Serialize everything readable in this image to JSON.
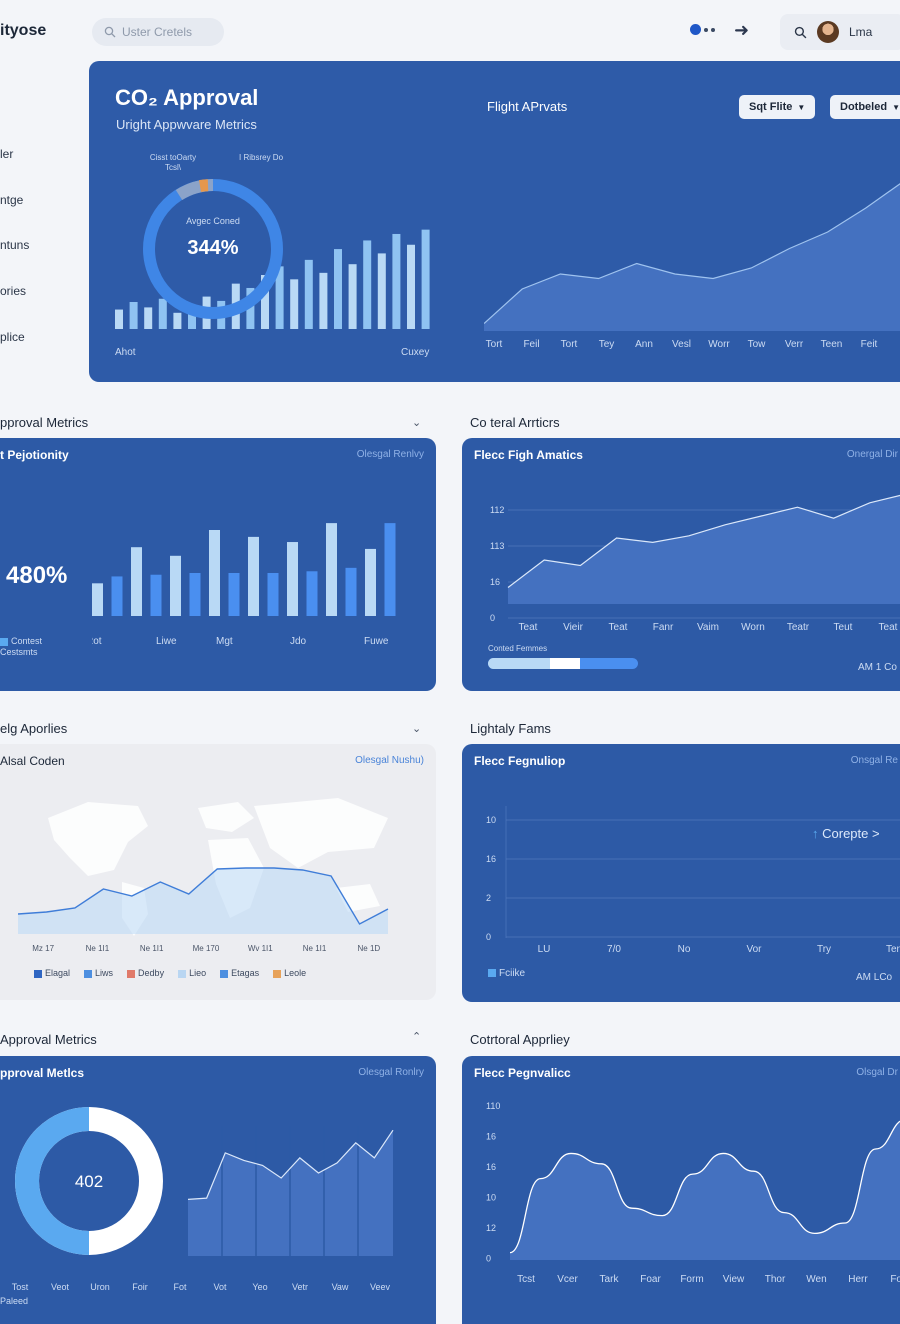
{
  "app": {
    "brand": "ityose",
    "search_placeholder": "Uster Cretels",
    "user_name": "Lma"
  },
  "sidebar": {
    "items": [
      "ler",
      "ntge",
      "ntuns",
      "ories",
      "plice"
    ]
  },
  "hero": {
    "title": "CO₂ Approval",
    "subtitle": "Uright Appwvare Metrics",
    "donut": {
      "label_top_left": "Cisst toOarty Tcsl\\",
      "label_top_right": "I Ribsrey Do",
      "center_caption": "Avgec Coned",
      "value": "344%",
      "percent": 344
    },
    "bars_left_label": "Ahot",
    "bars_right_label": "Cuxey",
    "bars": [
      0.18,
      0.25,
      0.2,
      0.28,
      0.15,
      0.22,
      0.3,
      0.26,
      0.42,
      0.38,
      0.5,
      0.58,
      0.46,
      0.64,
      0.52,
      0.74,
      0.6,
      0.82,
      0.7,
      0.88,
      0.78,
      0.92
    ],
    "right_title": "Flight APrvats",
    "filter_label": "Sqt Flite",
    "detail_label": "Dotbeled",
    "area_x": [
      "Tort",
      "Feil",
      "Tort",
      "Tey",
      "Ann",
      "Vesl",
      "Worr",
      "Tow",
      "Verr",
      "Teen",
      "Feit"
    ],
    "area_values": [
      0.05,
      0.28,
      0.38,
      0.35,
      0.45,
      0.38,
      0.35,
      0.42,
      0.55,
      0.66,
      0.82,
      1.0
    ]
  },
  "section2": {
    "left_heading": "pproval Metrics",
    "right_heading": "Co teral Arrticrs",
    "left_card": {
      "title": "t Pejotionity",
      "link": "Olesgal Renlvy",
      "value": "480%",
      "legend": "Contest Cestsmts",
      "x_labels": [
        "Rot",
        "Liwe",
        "Mgt",
        "Jdo",
        "Fuwe"
      ],
      "bars": [
        0.38,
        0.46,
        0.8,
        0.48,
        0.7,
        0.5,
        1.0,
        0.5,
        0.92,
        0.5,
        0.86,
        0.52,
        1.08,
        0.56,
        0.78,
        1.08
      ]
    },
    "right_card": {
      "title": "Flecc Figh Amatics",
      "link": "Onergal Dir",
      "y_ticks": [
        "112",
        "113",
        "16",
        "0"
      ],
      "x_labels": [
        "Teat",
        "Vieir",
        "Teat",
        "Fanr",
        "Vaim",
        "Worn",
        "Teatr",
        "Teut",
        "Teat"
      ],
      "values": [
        0.15,
        0.4,
        0.35,
        0.6,
        0.56,
        0.62,
        0.72,
        0.8,
        0.88,
        0.78,
        0.92,
        1.0
      ],
      "progress_label": "Conted Femmes",
      "progress": 0.6,
      "footer": "AM 1 Co"
    }
  },
  "section3": {
    "left_heading": "elg Aporlies",
    "right_heading": "Lightaly Fams",
    "left_card": {
      "title": "Alsal Coden",
      "link": "Olesgal Nushu)",
      "x_labels": [
        "Mz 17",
        "Ne 1I1",
        "Ne 1I1",
        "Me 170",
        "Wv 1I1",
        "Ne 1I1",
        "Ne 1D"
      ],
      "legend": [
        {
          "label": "Elagal",
          "color": "#2f66c2"
        },
        {
          "label": "Liws",
          "color": "#4d8fe0"
        },
        {
          "label": "Dedby",
          "color": "#e07a6a"
        },
        {
          "label": "Lieo",
          "color": "#b9d6f2"
        },
        {
          "label": "Etagas",
          "color": "#4d8fe0"
        },
        {
          "label": "Leole",
          "color": "#e7a25a"
        }
      ],
      "values": [
        0.2,
        0.22,
        0.26,
        0.45,
        0.38,
        0.52,
        0.4,
        0.65,
        0.66,
        0.66,
        0.64,
        0.58,
        0.1,
        0.25
      ]
    },
    "right_card": {
      "title": "Flecc Fegnuliop",
      "link": "Onsgal Re",
      "y_ticks": [
        "10",
        "16",
        "2",
        "0"
      ],
      "x_labels": [
        "LU",
        "7/0",
        "No",
        "Vor",
        "Try",
        "Ten"
      ],
      "compare_label": "Corepte >",
      "legend": "Fciike",
      "footer": "AM LCo"
    }
  },
  "section4": {
    "left_heading": "Approval Metrics",
    "right_heading": "Cotrtoral Apprliey",
    "left_card": {
      "title": "pproval Metlcs",
      "link": "Olesgal Ronlry",
      "donut_value": "402",
      "donut_fraction": 0.5,
      "x_labels": [
        "Tost",
        "Veot",
        "Uron",
        "Foir",
        "Fot",
        "Vot",
        "Yeo",
        "Vetr",
        "Vaw",
        "Veev"
      ],
      "footer_label": "Paleed",
      "values": [
        0.45,
        0.46,
        0.82,
        0.76,
        0.72,
        0.62,
        0.78,
        0.66,
        0.74,
        0.9,
        0.78,
        1.0
      ]
    },
    "right_card": {
      "title": "Flecc Pegnvalicc",
      "link": "Olsgal Dr",
      "y_ticks": [
        "110",
        "16",
        "16",
        "10",
        "12",
        "0"
      ],
      "x_labels": [
        "Tcst",
        "Vcer",
        "Tark",
        "Foar",
        "Form",
        "View",
        "Thor",
        "Wen",
        "Herr",
        "Forr"
      ],
      "values": [
        0.05,
        0.55,
        0.72,
        0.65,
        0.35,
        0.3,
        0.58,
        0.72,
        0.6,
        0.32,
        0.18,
        0.25,
        0.75,
        0.95
      ]
    }
  },
  "colors": {
    "card_blue": "#2d5aa6",
    "bar_light": "#b9d9f5",
    "bar_mid": "#4a8ff0",
    "area_fill": "#4471c0",
    "accent": "#5aa9f0"
  }
}
